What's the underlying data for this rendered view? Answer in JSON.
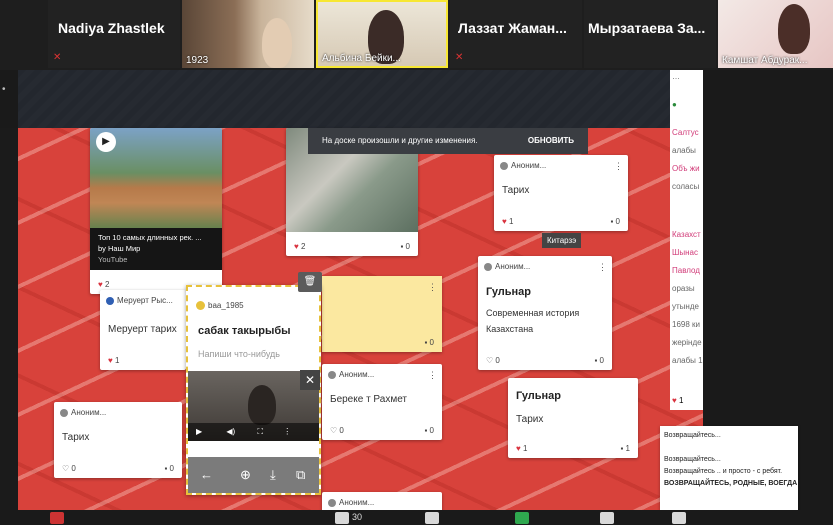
{
  "participants": {
    "p1_name": "Nadiya Zhastlek",
    "p2_label": "1923",
    "p3_label": "Альбина Бейки...",
    "p4_name": "Лаззат  Жаман...",
    "p5_name": "Мырзатаева  За...",
    "p6_label": "Камшат Абдурак..."
  },
  "toast": {
    "message": "На доске произошли и другие изменения.",
    "action": "ОБНОВИТЬ"
  },
  "cards": {
    "youtube": {
      "title": "Топ 10 самых длинных рек. ...",
      "by": "by Наш Мир",
      "source": "YouTube",
      "likes": "2"
    },
    "map": {
      "likes": "2",
      "comments": "0"
    },
    "tarikh1": {
      "author": "Аноним...",
      "text": "Тарих",
      "likes": "1",
      "comments": "0"
    },
    "meruert": {
      "author": "Меруерт Рыс...",
      "text": "Меруерт тарих",
      "likes": "1"
    },
    "yellow": {
      "author": "baa_1985",
      "title": "сабак такырыбы",
      "placeholder": "Напиши что-нибудь"
    },
    "sticky": {
      "comments": "0"
    },
    "gulnar1": {
      "author": "Аноним...",
      "title": "Гульнар",
      "line1": "Современная история",
      "line2": "Казахстана",
      "likes": "0",
      "comments": "0"
    },
    "beremet": {
      "author": "Аноним...",
      "text": "Береке т  Рахмет",
      "likes": "0",
      "comments": "0"
    },
    "tarikh_left": {
      "author": "Аноним...",
      "text": "Тарих",
      "likes": "0",
      "comments": "0"
    },
    "gulnar2": {
      "title": "Гульнар",
      "text": "Тарих",
      "likes": "1",
      "comments": "1"
    },
    "bottom_author": "Аноним..."
  },
  "tag": "Китарзэ",
  "side_panel": {
    "lines": [
      "Салтус",
      "алабы",
      "Объ жи",
      "соласы",
      "Казахст",
      "Шынас",
      "Павлод",
      "оразы",
      "утынде",
      "1698 ки",
      "жерінде",
      "алабы 1"
    ],
    "likes": "1"
  },
  "bottom_note": {
    "lines": [
      "Возвращайтесь...",
      "Возвращайтесь...",
      "Возвращайтесь .. и просто - с ребят.",
      "ВОЗВРАЩАЙТЕСЬ, РОДНЫЕ, ВОЕГДА"
    ]
  },
  "taskbar": {
    "count": "30"
  }
}
